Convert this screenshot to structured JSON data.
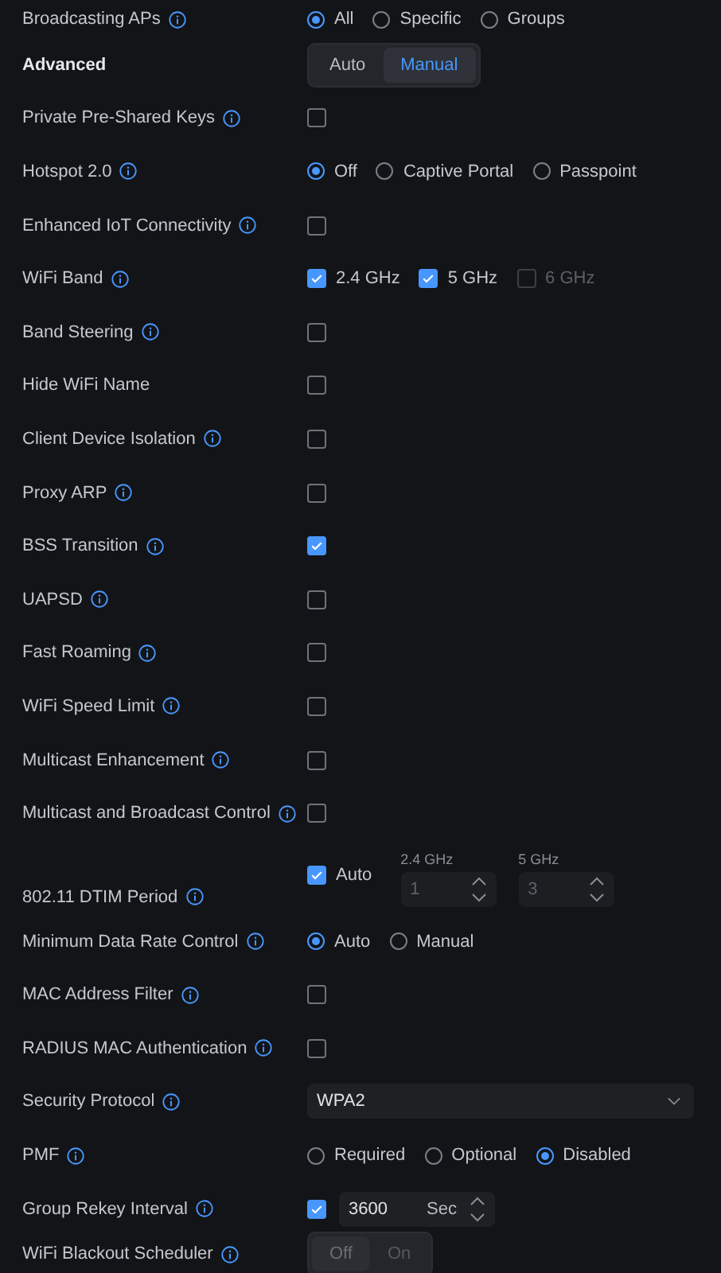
{
  "rows": [
    {
      "kind": "radio",
      "label": "Broadcasting APs",
      "info": true,
      "options": [
        {
          "label": "All",
          "selected": true
        },
        {
          "label": "Specific",
          "selected": false
        },
        {
          "label": "Groups",
          "selected": false
        }
      ]
    },
    {
      "kind": "section",
      "label": "Advanced",
      "info": false,
      "options": [
        {
          "label": "Auto",
          "selected": false
        },
        {
          "label": "Manual",
          "selected": true
        }
      ]
    },
    {
      "kind": "checkbox",
      "label": "Private Pre-Shared Keys",
      "info": true,
      "checked": false
    },
    {
      "kind": "radio",
      "label": "Hotspot 2.0",
      "info": true,
      "options": [
        {
          "label": "Off",
          "selected": true
        },
        {
          "label": "Captive Portal",
          "selected": false
        },
        {
          "label": "Passpoint",
          "selected": false
        }
      ]
    },
    {
      "kind": "checkbox",
      "label": "Enhanced IoT Connectivity",
      "info": true,
      "checked": false
    },
    {
      "kind": "checkbox_group",
      "label": "WiFi Band",
      "info": true,
      "options": [
        {
          "label": "2.4 GHz",
          "checked": true,
          "disabled": false
        },
        {
          "label": "5 GHz",
          "checked": true,
          "disabled": false
        },
        {
          "label": "6 GHz",
          "checked": false,
          "disabled": true
        }
      ]
    },
    {
      "kind": "checkbox",
      "label": "Band Steering",
      "info": true,
      "checked": false
    },
    {
      "kind": "checkbox",
      "label": "Hide WiFi Name",
      "info": false,
      "checked": false
    },
    {
      "kind": "checkbox",
      "label": "Client Device Isolation",
      "info": true,
      "checked": false
    },
    {
      "kind": "checkbox",
      "label": "Proxy ARP",
      "info": true,
      "checked": false
    },
    {
      "kind": "checkbox",
      "label": "BSS Transition",
      "info": true,
      "checked": true
    },
    {
      "kind": "checkbox",
      "label": "UAPSD",
      "info": true,
      "checked": false
    },
    {
      "kind": "checkbox",
      "label": "Fast Roaming",
      "info": true,
      "checked": false
    },
    {
      "kind": "checkbox",
      "label": "WiFi Speed Limit",
      "info": true,
      "checked": false
    },
    {
      "kind": "checkbox",
      "label": "Multicast Enhancement",
      "info": true,
      "checked": false
    },
    {
      "kind": "checkbox",
      "label": "Multicast and Broadcast Control",
      "info": true,
      "checked": false
    },
    {
      "kind": "dtim",
      "label": "802.11 DTIM Period",
      "info": true,
      "auto": {
        "label": "Auto",
        "checked": true
      },
      "fields": [
        {
          "caption": "2.4 GHz",
          "value": "1",
          "disabled": true
        },
        {
          "caption": "5 GHz",
          "value": "3",
          "disabled": true
        }
      ]
    },
    {
      "kind": "radio",
      "label": "Minimum Data Rate Control",
      "info": true,
      "options": [
        {
          "label": "Auto",
          "selected": true
        },
        {
          "label": "Manual",
          "selected": false
        }
      ]
    },
    {
      "kind": "checkbox",
      "label": "MAC Address Filter",
      "info": true,
      "checked": false
    },
    {
      "kind": "checkbox",
      "label": "RADIUS MAC Authentication",
      "info": true,
      "checked": false
    },
    {
      "kind": "select",
      "label": "Security Protocol",
      "info": true,
      "value": "WPA2"
    },
    {
      "kind": "radio",
      "label": "PMF",
      "info": true,
      "options": [
        {
          "label": "Required",
          "selected": false
        },
        {
          "label": "Optional",
          "selected": false
        },
        {
          "label": "Disabled",
          "selected": true
        }
      ]
    },
    {
      "kind": "rekey",
      "label": "Group Rekey Interval",
      "info": true,
      "checked": true,
      "value": "3600",
      "unit": "Sec"
    },
    {
      "kind": "toggle",
      "label": "WiFi Blackout Scheduler",
      "info": true,
      "options": [
        {
          "label": "Off",
          "selected": true
        },
        {
          "label": "On",
          "selected": false
        }
      ]
    }
  ]
}
